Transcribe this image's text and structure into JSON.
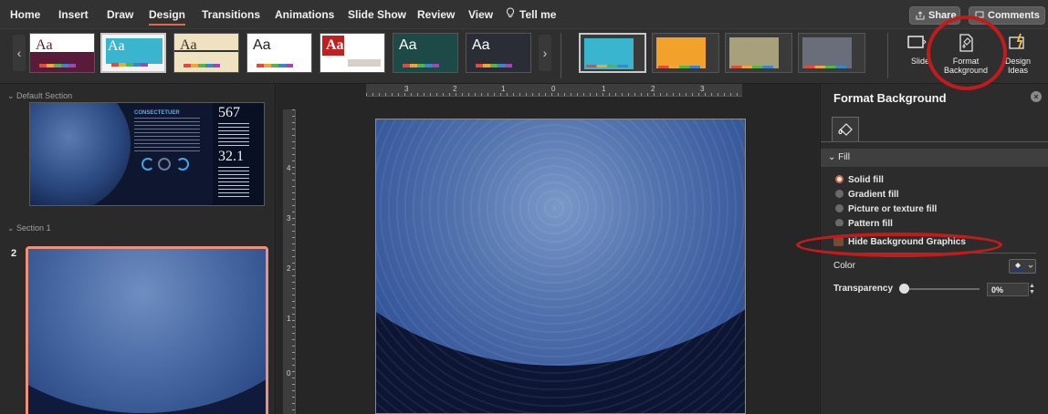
{
  "menubar": {
    "tabs": [
      "Home",
      "Insert",
      "Draw",
      "Design",
      "Transitions",
      "Animations",
      "Slide Show",
      "Review",
      "View"
    ],
    "active_tab": "Design",
    "tell_me": "Tell me",
    "share": "Share",
    "comments": "Comments"
  },
  "ribbon": {
    "themes": [
      {
        "label": "Aa",
        "bg": "#ffffff",
        "accent": "#5a1a3a"
      },
      {
        "label": "Aa",
        "bg": "#3ab5cf",
        "accent": "#ffffff"
      },
      {
        "label": "Aa",
        "bg": "#efe2c0",
        "accent": "#333333"
      },
      {
        "label": "Aa",
        "bg": "#ffffff",
        "accent": "#222222"
      },
      {
        "label": "Aa",
        "bg": "#ffffff",
        "accent": "#c02020"
      },
      {
        "label": "Aa",
        "bg": "#1d4a47",
        "accent": "#ffffff"
      },
      {
        "label": "Aa",
        "bg": "#2a2d36",
        "accent": "#ffffff"
      }
    ],
    "variants": [
      {
        "color": "#3ab5cf"
      },
      {
        "color": "#f2a12a"
      },
      {
        "color": "#a8a07a"
      },
      {
        "color": "#6a6e7a"
      }
    ],
    "slide_size": "Slide Size",
    "format_background_line1": "Format",
    "format_background_line2": "Background",
    "design_ideas_line1": "Design",
    "design_ideas_line2": "Ideas"
  },
  "left_panel": {
    "section_default": "Default Section",
    "section_1": "Section 1",
    "slide_number": "2",
    "thumb1": {
      "heading": "CONSECTETUER",
      "stat1": "567",
      "stat2": "32.1"
    }
  },
  "ruler": {
    "h_ticks": [
      "3",
      "2",
      "1",
      "0",
      "1",
      "2",
      "3"
    ],
    "v_ticks": [
      "4",
      "3",
      "2",
      "1",
      "0"
    ]
  },
  "format_pane": {
    "title": "Format Background",
    "fill_section": "Fill",
    "options": [
      "Solid fill",
      "Gradient fill",
      "Picture or texture fill",
      "Pattern fill"
    ],
    "selected_option": "Solid fill",
    "hide_graphics": "Hide Background Graphics",
    "color_label": "Color",
    "transparency_label": "Transparency",
    "transparency_value": "0%"
  },
  "colors": {
    "active_tab_underline": "#e06a4c",
    "selected_slide_border": "#f0907a",
    "annotation": "#c01c1c",
    "radio_selected": "#d06a3c"
  }
}
